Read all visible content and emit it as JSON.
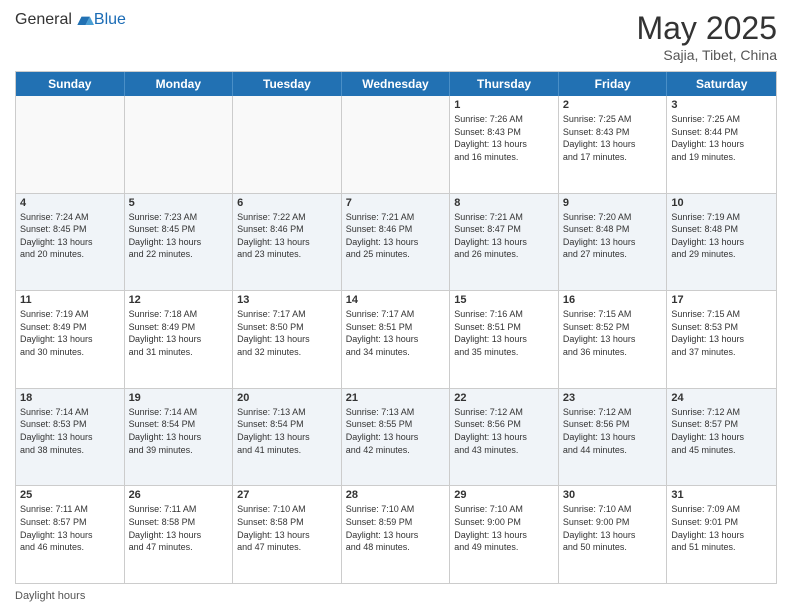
{
  "header": {
    "logo_general": "General",
    "logo_blue": "Blue",
    "month_year": "May 2025",
    "location": "Sajia, Tibet, China"
  },
  "weekdays": [
    "Sunday",
    "Monday",
    "Tuesday",
    "Wednesday",
    "Thursday",
    "Friday",
    "Saturday"
  ],
  "footer": {
    "daylight_hours": "Daylight hours"
  },
  "rows": [
    {
      "alt": false,
      "cells": [
        {
          "day": "",
          "empty": true,
          "lines": []
        },
        {
          "day": "",
          "empty": true,
          "lines": []
        },
        {
          "day": "",
          "empty": true,
          "lines": []
        },
        {
          "day": "",
          "empty": true,
          "lines": []
        },
        {
          "day": "1",
          "empty": false,
          "lines": [
            "Sunrise: 7:26 AM",
            "Sunset: 8:43 PM",
            "Daylight: 13 hours",
            "and 16 minutes."
          ]
        },
        {
          "day": "2",
          "empty": false,
          "lines": [
            "Sunrise: 7:25 AM",
            "Sunset: 8:43 PM",
            "Daylight: 13 hours",
            "and 17 minutes."
          ]
        },
        {
          "day": "3",
          "empty": false,
          "lines": [
            "Sunrise: 7:25 AM",
            "Sunset: 8:44 PM",
            "Daylight: 13 hours",
            "and 19 minutes."
          ]
        }
      ]
    },
    {
      "alt": true,
      "cells": [
        {
          "day": "4",
          "empty": false,
          "lines": [
            "Sunrise: 7:24 AM",
            "Sunset: 8:45 PM",
            "Daylight: 13 hours",
            "and 20 minutes."
          ]
        },
        {
          "day": "5",
          "empty": false,
          "lines": [
            "Sunrise: 7:23 AM",
            "Sunset: 8:45 PM",
            "Daylight: 13 hours",
            "and 22 minutes."
          ]
        },
        {
          "day": "6",
          "empty": false,
          "lines": [
            "Sunrise: 7:22 AM",
            "Sunset: 8:46 PM",
            "Daylight: 13 hours",
            "and 23 minutes."
          ]
        },
        {
          "day": "7",
          "empty": false,
          "lines": [
            "Sunrise: 7:21 AM",
            "Sunset: 8:46 PM",
            "Daylight: 13 hours",
            "and 25 minutes."
          ]
        },
        {
          "day": "8",
          "empty": false,
          "lines": [
            "Sunrise: 7:21 AM",
            "Sunset: 8:47 PM",
            "Daylight: 13 hours",
            "and 26 minutes."
          ]
        },
        {
          "day": "9",
          "empty": false,
          "lines": [
            "Sunrise: 7:20 AM",
            "Sunset: 8:48 PM",
            "Daylight: 13 hours",
            "and 27 minutes."
          ]
        },
        {
          "day": "10",
          "empty": false,
          "lines": [
            "Sunrise: 7:19 AM",
            "Sunset: 8:48 PM",
            "Daylight: 13 hours",
            "and 29 minutes."
          ]
        }
      ]
    },
    {
      "alt": false,
      "cells": [
        {
          "day": "11",
          "empty": false,
          "lines": [
            "Sunrise: 7:19 AM",
            "Sunset: 8:49 PM",
            "Daylight: 13 hours",
            "and 30 minutes."
          ]
        },
        {
          "day": "12",
          "empty": false,
          "lines": [
            "Sunrise: 7:18 AM",
            "Sunset: 8:49 PM",
            "Daylight: 13 hours",
            "and 31 minutes."
          ]
        },
        {
          "day": "13",
          "empty": false,
          "lines": [
            "Sunrise: 7:17 AM",
            "Sunset: 8:50 PM",
            "Daylight: 13 hours",
            "and 32 minutes."
          ]
        },
        {
          "day": "14",
          "empty": false,
          "lines": [
            "Sunrise: 7:17 AM",
            "Sunset: 8:51 PM",
            "Daylight: 13 hours",
            "and 34 minutes."
          ]
        },
        {
          "day": "15",
          "empty": false,
          "lines": [
            "Sunrise: 7:16 AM",
            "Sunset: 8:51 PM",
            "Daylight: 13 hours",
            "and 35 minutes."
          ]
        },
        {
          "day": "16",
          "empty": false,
          "lines": [
            "Sunrise: 7:15 AM",
            "Sunset: 8:52 PM",
            "Daylight: 13 hours",
            "and 36 minutes."
          ]
        },
        {
          "day": "17",
          "empty": false,
          "lines": [
            "Sunrise: 7:15 AM",
            "Sunset: 8:53 PM",
            "Daylight: 13 hours",
            "and 37 minutes."
          ]
        }
      ]
    },
    {
      "alt": true,
      "cells": [
        {
          "day": "18",
          "empty": false,
          "lines": [
            "Sunrise: 7:14 AM",
            "Sunset: 8:53 PM",
            "Daylight: 13 hours",
            "and 38 minutes."
          ]
        },
        {
          "day": "19",
          "empty": false,
          "lines": [
            "Sunrise: 7:14 AM",
            "Sunset: 8:54 PM",
            "Daylight: 13 hours",
            "and 39 minutes."
          ]
        },
        {
          "day": "20",
          "empty": false,
          "lines": [
            "Sunrise: 7:13 AM",
            "Sunset: 8:54 PM",
            "Daylight: 13 hours",
            "and 41 minutes."
          ]
        },
        {
          "day": "21",
          "empty": false,
          "lines": [
            "Sunrise: 7:13 AM",
            "Sunset: 8:55 PM",
            "Daylight: 13 hours",
            "and 42 minutes."
          ]
        },
        {
          "day": "22",
          "empty": false,
          "lines": [
            "Sunrise: 7:12 AM",
            "Sunset: 8:56 PM",
            "Daylight: 13 hours",
            "and 43 minutes."
          ]
        },
        {
          "day": "23",
          "empty": false,
          "lines": [
            "Sunrise: 7:12 AM",
            "Sunset: 8:56 PM",
            "Daylight: 13 hours",
            "and 44 minutes."
          ]
        },
        {
          "day": "24",
          "empty": false,
          "lines": [
            "Sunrise: 7:12 AM",
            "Sunset: 8:57 PM",
            "Daylight: 13 hours",
            "and 45 minutes."
          ]
        }
      ]
    },
    {
      "alt": false,
      "cells": [
        {
          "day": "25",
          "empty": false,
          "lines": [
            "Sunrise: 7:11 AM",
            "Sunset: 8:57 PM",
            "Daylight: 13 hours",
            "and 46 minutes."
          ]
        },
        {
          "day": "26",
          "empty": false,
          "lines": [
            "Sunrise: 7:11 AM",
            "Sunset: 8:58 PM",
            "Daylight: 13 hours",
            "and 47 minutes."
          ]
        },
        {
          "day": "27",
          "empty": false,
          "lines": [
            "Sunrise: 7:10 AM",
            "Sunset: 8:58 PM",
            "Daylight: 13 hours",
            "and 47 minutes."
          ]
        },
        {
          "day": "28",
          "empty": false,
          "lines": [
            "Sunrise: 7:10 AM",
            "Sunset: 8:59 PM",
            "Daylight: 13 hours",
            "and 48 minutes."
          ]
        },
        {
          "day": "29",
          "empty": false,
          "lines": [
            "Sunrise: 7:10 AM",
            "Sunset: 9:00 PM",
            "Daylight: 13 hours",
            "and 49 minutes."
          ]
        },
        {
          "day": "30",
          "empty": false,
          "lines": [
            "Sunrise: 7:10 AM",
            "Sunset: 9:00 PM",
            "Daylight: 13 hours",
            "and 50 minutes."
          ]
        },
        {
          "day": "31",
          "empty": false,
          "lines": [
            "Sunrise: 7:09 AM",
            "Sunset: 9:01 PM",
            "Daylight: 13 hours",
            "and 51 minutes."
          ]
        }
      ]
    }
  ]
}
